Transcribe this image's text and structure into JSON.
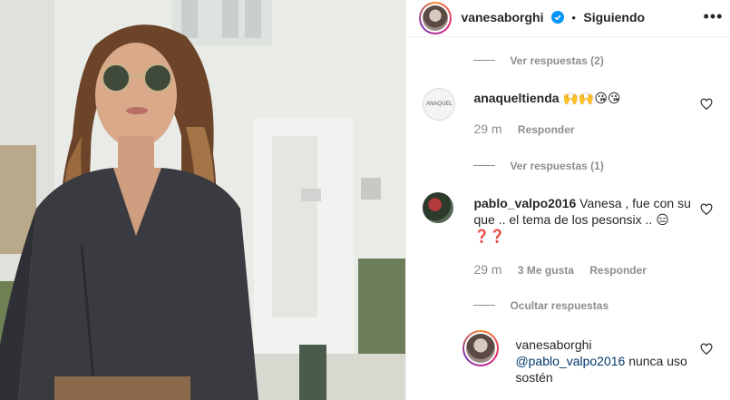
{
  "header": {
    "username": "vanesaborghi",
    "separator": "•",
    "follow_status": "Siguiendo",
    "more_label": "•••"
  },
  "thread": {
    "view_replies_1": "Ver respuestas (2)",
    "comment1": {
      "username": "anaqueltienda",
      "avatar_text": "ANAQUEL",
      "text": "🙌🙌😘😘",
      "time": "29 m",
      "reply_label": "Responder"
    },
    "view_replies_2": "Ver respuestas (1)",
    "comment2": {
      "username": "pablo_valpo2016",
      "text": "Vanesa , fue con su que .. el tema de los pesonsix .. 😑❓❓",
      "time": "29 m",
      "likes": "3 Me gusta",
      "reply_label": "Responder"
    },
    "hide_replies": "Ocultar respuestas",
    "reply1": {
      "username": "vanesaborghi",
      "mention": "@pablo_valpo2016",
      "text": " nunca uso sostén"
    }
  },
  "colors": {
    "text": "#262626",
    "muted": "#8e8e8e",
    "link": "#00376b",
    "verified": "#0095f6"
  }
}
